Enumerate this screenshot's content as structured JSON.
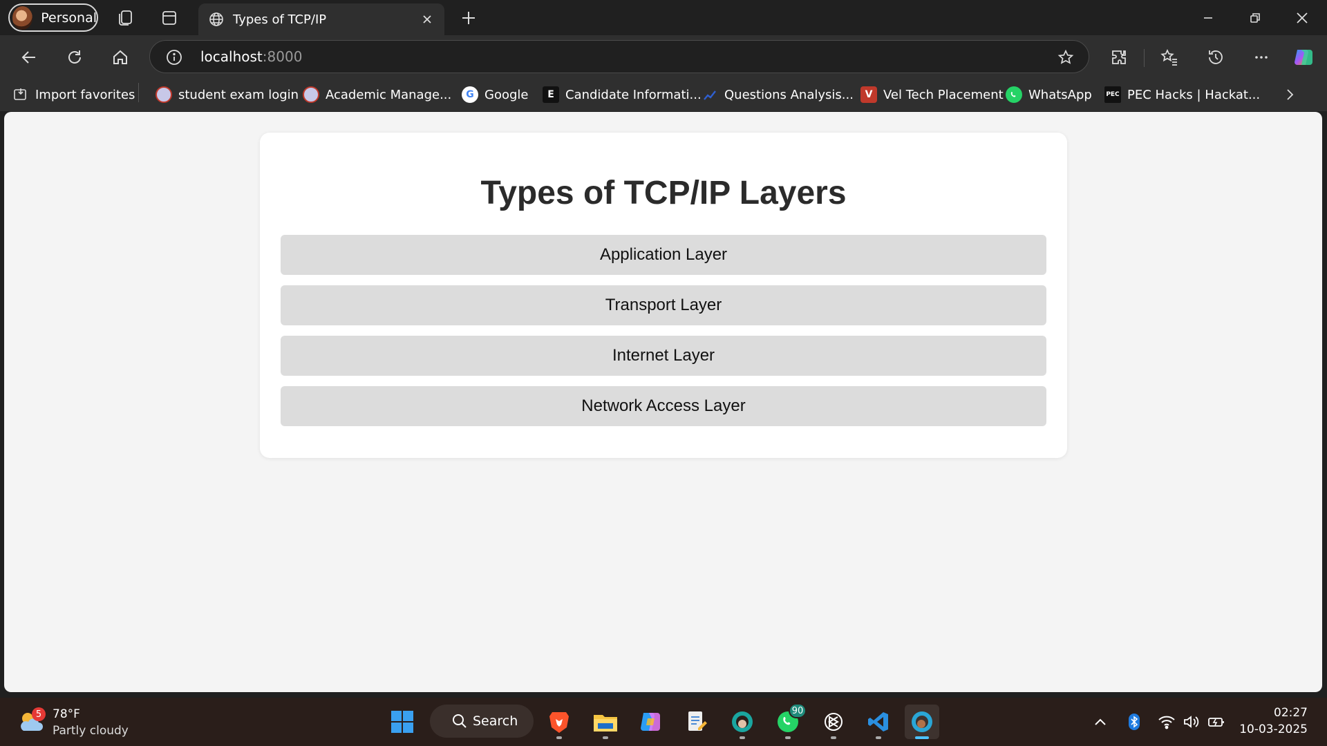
{
  "browser": {
    "profile_label": "Personal",
    "tab_title": "Types of TCP/IP",
    "address_host": "localhost",
    "address_port": ":8000"
  },
  "bookmarks": [
    {
      "label": "Import favorites",
      "icon": "import-icon"
    },
    {
      "label": "student exam login",
      "icon": "university-seal-icon"
    },
    {
      "label": "Academic Manage...",
      "icon": "university-seal-icon"
    },
    {
      "label": "Google",
      "icon": "google-icon"
    },
    {
      "label": "Candidate Informati...",
      "icon": "e-logo-icon"
    },
    {
      "label": "Questions Analysis...",
      "icon": "chart-logo-icon"
    },
    {
      "label": "Vel Tech Placement",
      "icon": "veltech-icon"
    },
    {
      "label": "WhatsApp",
      "icon": "whatsapp-icon"
    },
    {
      "label": "PEC Hacks | Hackat...",
      "icon": "pec-icon"
    }
  ],
  "page": {
    "title": "Types of TCP/IP Layers",
    "layers": [
      "Application Layer",
      "Transport Layer",
      "Internet Layer",
      "Network Access Layer"
    ]
  },
  "taskbar": {
    "weather_temp": "78°F",
    "weather_desc": "Partly cloudy",
    "weather_badge": "5",
    "search_label": "Search",
    "whatsapp_badge": "90",
    "time": "02:27",
    "date": "10-03-2025"
  },
  "colors": {
    "accent": "#4cc2ff",
    "button_bg": "#dcdcdc",
    "page_bg": "#f4f4f4"
  }
}
